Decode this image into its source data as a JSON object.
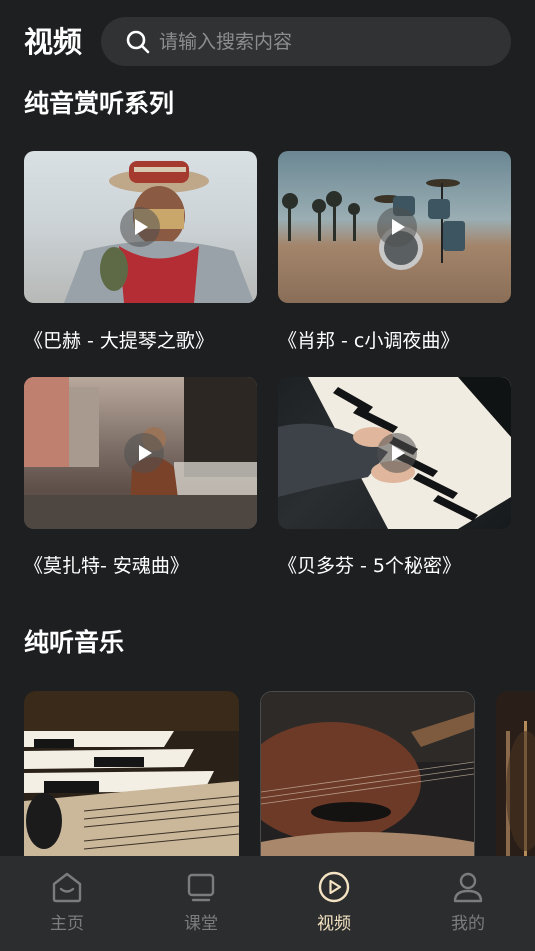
{
  "header": {
    "title": "视频",
    "search": {
      "placeholder": "请输入搜索内容",
      "value": ""
    }
  },
  "sections": [
    {
      "title": "纯音赏听系列",
      "items": [
        {
          "title": "《巴赫 - 大提琴之歌》"
        },
        {
          "title": "《肖邦 - c小调夜曲》"
        },
        {
          "title": "《莫扎特- 安魂曲》"
        },
        {
          "title": "《贝多芬 - 5个秘密》"
        }
      ]
    },
    {
      "title": "纯听音乐",
      "items": []
    }
  ],
  "bottom_nav": [
    {
      "label": "主页",
      "icon": "home-icon",
      "active": false
    },
    {
      "label": "课堂",
      "icon": "classroom-icon",
      "active": false
    },
    {
      "label": "视频",
      "icon": "video-play-icon",
      "active": true
    },
    {
      "label": "我的",
      "icon": "profile-icon",
      "active": false
    }
  ],
  "colors": {
    "background": "#1e1f20",
    "accent": "#f3e3c3",
    "nav_inactive": "#7b7c7e"
  }
}
